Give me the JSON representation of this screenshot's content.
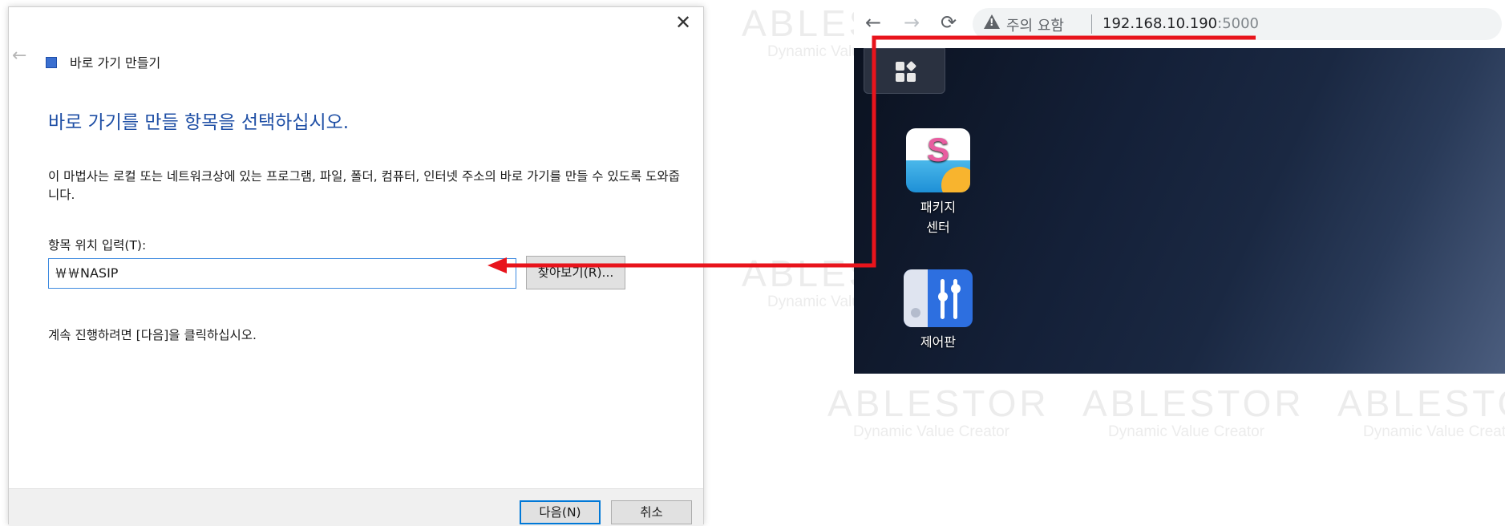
{
  "watermark": {
    "brand": "ABLESTOR",
    "tagline": "Dynamic Value Creator"
  },
  "dialog": {
    "title": "바로 가기 만들기",
    "heading": "바로 가기를 만들 항목을 선택하십시오.",
    "description": "이 마법사는 로컬 또는 네트워크상에 있는 프로그램, 파일, 폴더, 컴퓨터, 인터넷 주소의 바로 가기를 만들 수 있도록 도와줍니다.",
    "field_label": "항목 위치 입력(T):",
    "location_value": "￦￦NASIP",
    "browse_label": "찾아보기(R)...",
    "continue_text": "계속 진행하려면 [다음]을 클릭하십시오.",
    "next_label": "다음(N)",
    "cancel_label": "취소",
    "close_glyph": "✕",
    "back_glyph": "←"
  },
  "browser": {
    "back_glyph": "←",
    "forward_glyph": "→",
    "reload_glyph": "⟳",
    "warning_text": "주의 요함",
    "url_host": "192.168.10.190",
    "url_port": ":5000",
    "desktop_apps": [
      {
        "label_line1": "패키지",
        "label_line2": "센터",
        "icon": "package-center-icon"
      },
      {
        "label_line1": "제어판",
        "icon": "control-panel-icon"
      }
    ]
  },
  "annotation_color": "#e8141c"
}
